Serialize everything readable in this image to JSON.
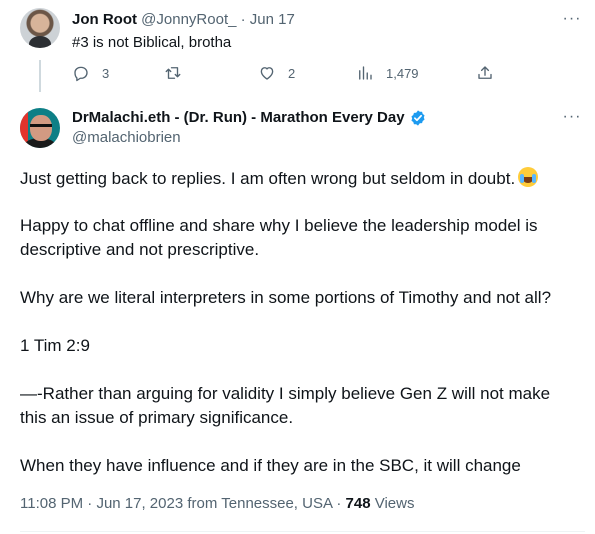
{
  "reply": {
    "author_name": "Jon Root",
    "handle": "@JonnyRoot_",
    "separator": "·",
    "date": "Jun 17",
    "text": "#3 is not Biblical, brotha",
    "more_label": "···",
    "actions": {
      "reply_count": "3",
      "retweet_count": "",
      "like_count": "2",
      "views_count": "1,479"
    }
  },
  "tweet": {
    "author_name": "DrMalachi.eth - (Dr. Run) - Marathon Every Day",
    "handle": "@malachiobrien",
    "more_label": "···",
    "lines": {
      "p1": "Just getting back to replies. I am often wrong but seldom in doubt.",
      "p2a": "Happy to chat offline and share why I believe the leadership model is",
      "p2b": "descriptive and not prescriptive.",
      "p3": "Why are we literal interpreters in some portions of Timothy and not all?",
      "p4": "1 Tim 2:9",
      "p5a": "—-Rather than arguing for validity I simply believe Gen Z will not make",
      "p5b": "this an issue of primary significance.",
      "p6": "When they have influence and if they are in the SBC, it will change"
    },
    "meta": {
      "time": "11:08 PM",
      "sep1": "·",
      "date": "Jun 17, 2023",
      "location": "from Tennessee, USA",
      "sep2": "·",
      "views_count": "748",
      "views_label": "Views"
    }
  },
  "colors": {
    "text": "#0f1419",
    "muted": "#536471",
    "verified": "#1d9bf0",
    "thread_line": "#cfd9de"
  },
  "icons": [
    "reply-icon",
    "retweet-icon",
    "like-icon",
    "views-icon",
    "share-icon",
    "verified-badge-icon",
    "more-icon",
    "tears-of-joy-emoji"
  ]
}
